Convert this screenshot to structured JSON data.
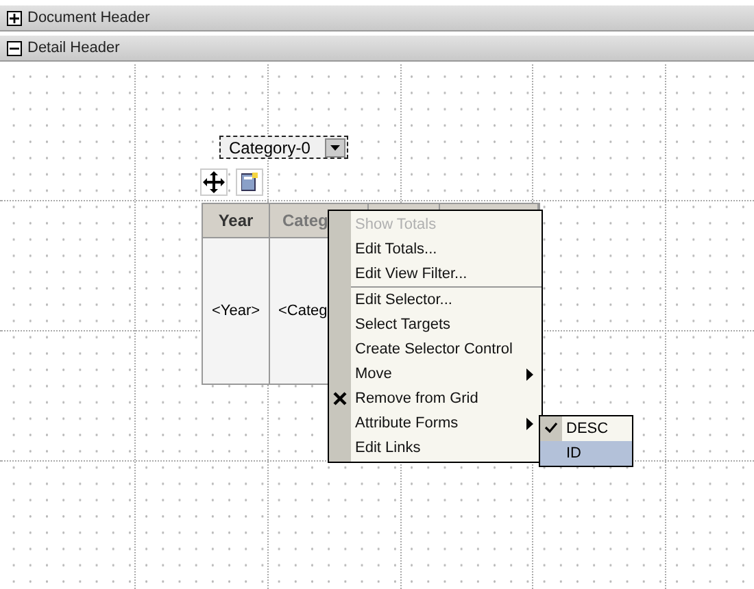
{
  "sections": [
    {
      "label": "Document Header",
      "expanded": false
    },
    {
      "label": "Detail Header",
      "expanded": true
    }
  ],
  "selector": {
    "value": "Category-0"
  },
  "grid": {
    "columns": [
      {
        "header": "Year",
        "cell": "<Year>"
      },
      {
        "header": "Categ",
        "cell": "<Categ"
      },
      {},
      {}
    ]
  },
  "context_menu": {
    "items": [
      {
        "label": "Show Totals",
        "disabled": true,
        "kind": "item"
      },
      {
        "label": "Edit Totals...",
        "disabled": false,
        "kind": "item"
      },
      {
        "label": "Edit View Filter...",
        "disabled": false,
        "kind": "item"
      },
      {
        "kind": "separator"
      },
      {
        "label": "Edit Selector...",
        "disabled": false,
        "kind": "item"
      },
      {
        "label": "Select Targets",
        "disabled": false,
        "kind": "item"
      },
      {
        "label": "Create Selector Control",
        "disabled": false,
        "kind": "item"
      },
      {
        "label": "Move",
        "disabled": false,
        "kind": "submenu"
      },
      {
        "label": "Remove from Grid",
        "disabled": false,
        "kind": "remove"
      },
      {
        "label": "Attribute Forms",
        "disabled": false,
        "kind": "submenu"
      },
      {
        "label": "Edit Links",
        "disabled": false,
        "kind": "item"
      }
    ]
  },
  "submenu": {
    "items": [
      {
        "label": "DESC",
        "checked": true,
        "selected": false
      },
      {
        "label": "ID",
        "checked": false,
        "selected": true
      }
    ]
  }
}
